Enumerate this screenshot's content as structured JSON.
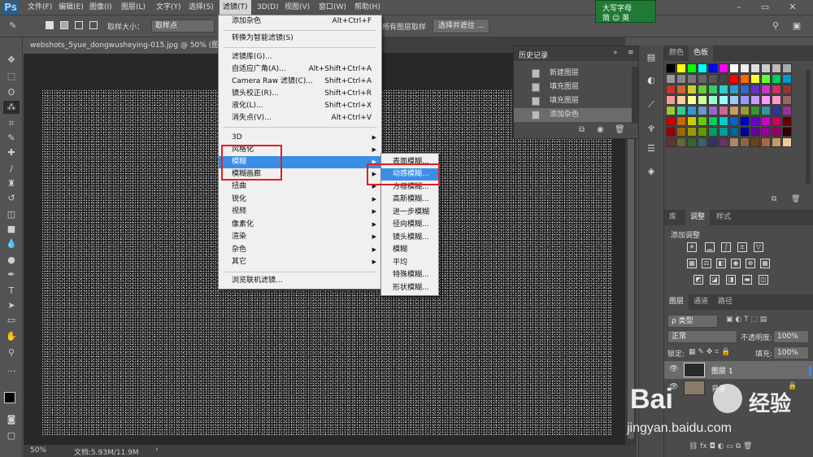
{
  "app": {
    "logo": "Ps"
  },
  "menubar": {
    "items": [
      "文件(F)",
      "编辑(E)",
      "图像(I)",
      "图层(L)",
      "文字(Y)",
      "选择(S)",
      "滤镜(T)",
      "3D(D)",
      "视图(V)",
      "窗口(W)",
      "帮助(H)"
    ],
    "active": "滤镜(T)"
  },
  "ime": {
    "line1": "大写字母",
    "line2": "简 ☺ 英"
  },
  "options": {
    "sample_size_label": "取样大小：",
    "sample_size_value": "取样点",
    "sample_all_layers": "所有图层取样",
    "select_and_mask": "选择并遮住 ..."
  },
  "document": {
    "tab_title": "webshots_5yue_dongwusheying-015.jpg @ 50% (图层 1, RG",
    "zoom": "50%",
    "doc_size": "文档:5.93M/11.9M"
  },
  "filter_menu": {
    "last_filter": {
      "label": "添加杂色",
      "shortcut": "Alt+Ctrl+F"
    },
    "convert_smart": "转换为智能滤镜(S)",
    "group2": [
      {
        "label": "滤镜库(G)...",
        "shortcut": ""
      },
      {
        "label": "自适应广角(A)...",
        "shortcut": "Alt+Shift+Ctrl+A"
      },
      {
        "label": "Camera Raw 滤镜(C)...",
        "shortcut": "Shift+Ctrl+A"
      },
      {
        "label": "镜头校正(R)...",
        "shortcut": "Shift+Ctrl+R"
      },
      {
        "label": "液化(L)...",
        "shortcut": "Shift+Ctrl+X"
      },
      {
        "label": "消失点(V)...",
        "shortcut": "Alt+Ctrl+V"
      }
    ],
    "group3": [
      "3D",
      "风格化",
      "模糊",
      "模糊画廊",
      "扭曲",
      "锐化",
      "视频",
      "像素化",
      "渲染",
      "杂色",
      "其它"
    ],
    "highlighted": "模糊",
    "browse_online": "浏览联机滤镜..."
  },
  "blur_submenu": {
    "items": [
      "表面模糊...",
      "动感模糊...",
      "方框模糊...",
      "高斯模糊...",
      "进一步模糊",
      "径向模糊...",
      "镜头模糊...",
      "模糊",
      "平均",
      "特殊模糊...",
      "形状模糊..."
    ],
    "highlighted": "动感模糊..."
  },
  "history": {
    "title": "历史记录",
    "items": [
      "新建图层",
      "填充图层",
      "填充图层",
      "添加杂色"
    ],
    "active": "添加杂色"
  },
  "color_panel": {
    "tabs": [
      "颜色",
      "色板"
    ],
    "active": "色板"
  },
  "adjust_panel": {
    "tabs": [
      "库",
      "调整",
      "样式"
    ],
    "active": "调整",
    "title": "添加调整"
  },
  "layers_panel": {
    "tabs": [
      "图层",
      "通道",
      "路径"
    ],
    "active": "图层",
    "filter_kind": "ρ 类型",
    "blend_mode": "正常",
    "opacity_label": "不透明度:",
    "opacity_value": "100%",
    "lock_label": "锁定:",
    "fill_label": "填充:",
    "fill_value": "100%",
    "layers": [
      {
        "name": "图层 1"
      },
      {
        "name": "背景"
      }
    ]
  },
  "watermark": {
    "brand": "Bai",
    "brand_cn": "经验",
    "url": "jingyan.baidu.com"
  }
}
